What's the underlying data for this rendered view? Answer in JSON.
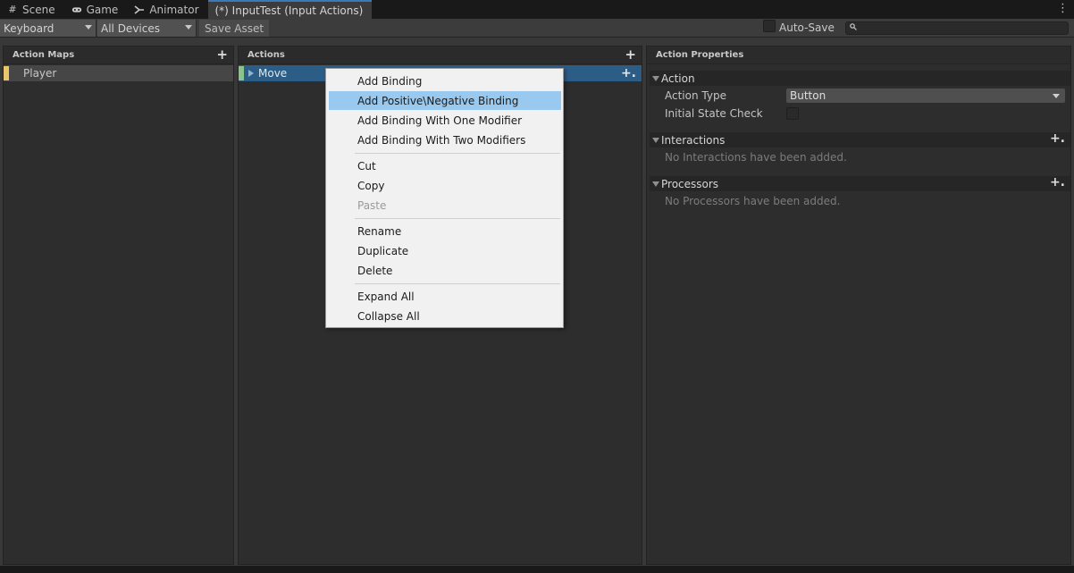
{
  "tabs": [
    {
      "label": "Scene",
      "icon": "grid-icon"
    },
    {
      "label": "Game",
      "icon": "gamepad-icon"
    },
    {
      "label": "Animator",
      "icon": "animator-icon"
    },
    {
      "label": "(*) InputTest (Input Actions)",
      "icon": ""
    }
  ],
  "toolbar": {
    "control_scheme": "Keyboard",
    "devices": "All Devices",
    "save_label": "Save Asset",
    "autosave_label": "Auto-Save",
    "search_placeholder": ""
  },
  "action_maps": {
    "header": "Action Maps",
    "items": [
      {
        "label": "Player",
        "color": "#e9c66b"
      }
    ]
  },
  "actions": {
    "header": "Actions",
    "items": [
      {
        "label": "Move",
        "color": "#8cc28c"
      }
    ]
  },
  "properties": {
    "header": "Action Properties",
    "action_section": "Action",
    "action_type_label": "Action Type",
    "action_type_value": "Button",
    "initial_state_label": "Initial State Check",
    "interactions_section": "Interactions",
    "interactions_empty": "No Interactions have been added.",
    "processors_section": "Processors",
    "processors_empty": "No Processors have been added."
  },
  "context_menu": {
    "items": [
      "Add Binding",
      "Add Positive\\Negative Binding",
      "Add Binding With One Modifier",
      "Add Binding With Two Modifiers",
      "Cut",
      "Copy",
      "Paste",
      "Rename",
      "Duplicate",
      "Delete",
      "Expand All",
      "Collapse All"
    ],
    "highlighted": "Add Positive\\Negative Binding",
    "disabled": [
      "Paste"
    ]
  }
}
